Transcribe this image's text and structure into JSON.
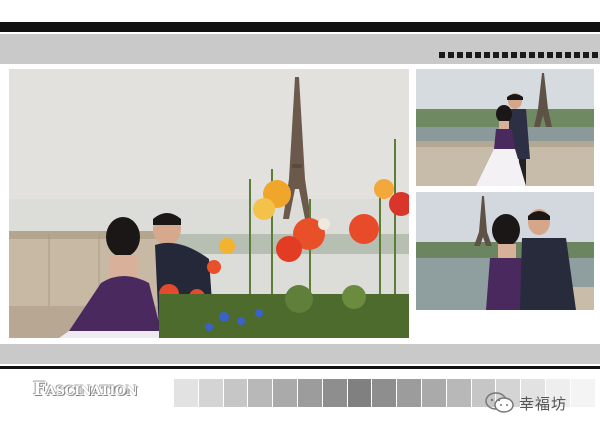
{
  "header": {
    "dot_count": 21
  },
  "photos": [
    {
      "name": "couple-eiffel-flowers",
      "sky": "#dcdcd8",
      "accent": "#e8502a"
    },
    {
      "name": "couple-seine-eiffel",
      "sky": "#d6dbe0"
    },
    {
      "name": "couple-kiss-eiffel",
      "sky": "#d2d8de"
    }
  ],
  "footer": {
    "brand_text": "Fascination",
    "swatch_colors": [
      "#e2e2e2",
      "#d4d4d4",
      "#c6c6c6",
      "#b8b8b8",
      "#aaaaaa",
      "#9c9c9c",
      "#8e8e8e",
      "#808080",
      "#8e8e8e",
      "#9c9c9c",
      "#aaaaaa",
      "#b8b8b8",
      "#c6c6c6",
      "#d4d4d4",
      "#e2e2e2",
      "#eeeeee",
      "#f4f4f4"
    ],
    "wechat_label": "幸福坊",
    "wechat_icon": "wechat-icon"
  }
}
